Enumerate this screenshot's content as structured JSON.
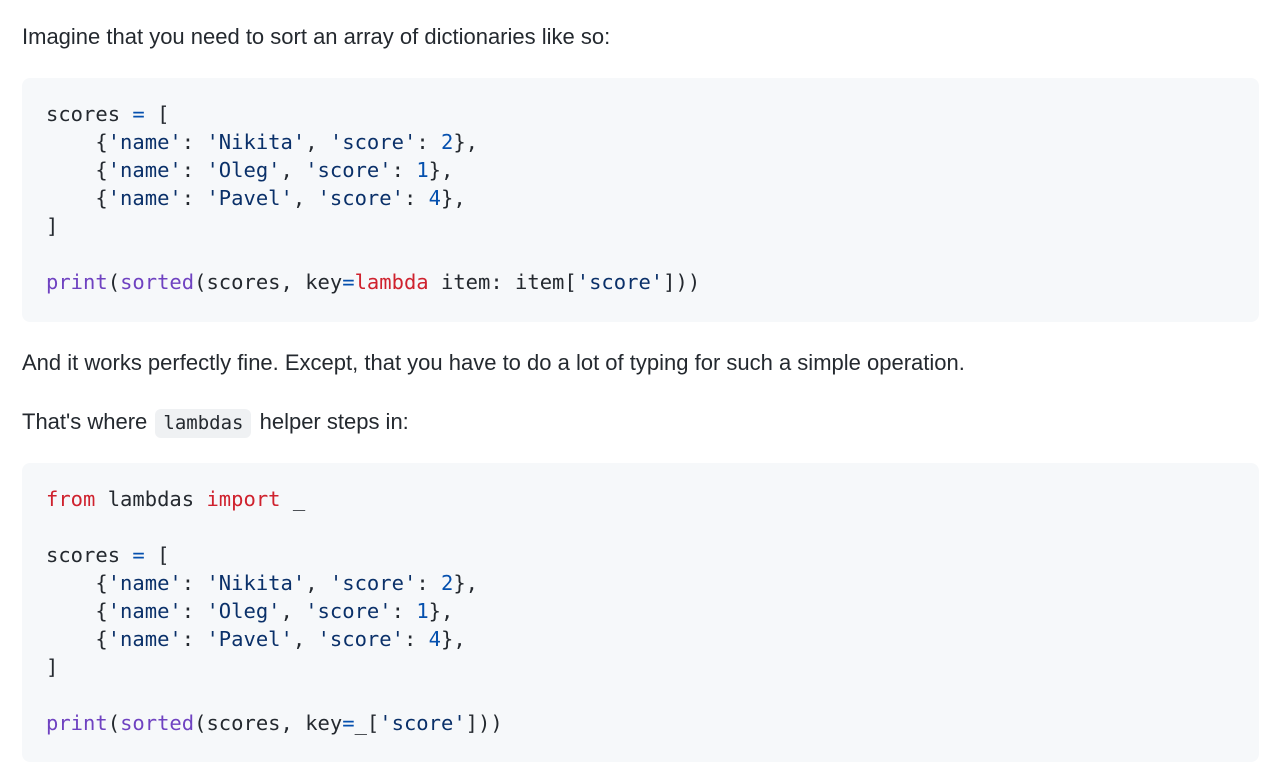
{
  "intro_text": "Imagine that you need to sort an array of dictionaries like so:",
  "middle_text": "And it works perfectly fine. Except, that you have to do a lot of typing for such a simple operation.",
  "helper": {
    "before": "That's where",
    "code": "lambdas",
    "after": "helper steps in:"
  },
  "colors": {
    "keyword": "#cf222e",
    "builtin": "#6f42c1",
    "string": "#0a3069",
    "number": "#0550ae",
    "code_background": "#f6f8fa",
    "inline_code_background": "#eff1f3"
  },
  "code_block_1": [
    [
      [
        "plain",
        "scores "
      ],
      [
        "op",
        "="
      ],
      [
        "plain",
        " ["
      ]
    ],
    [
      [
        "plain",
        "    {"
      ],
      [
        "str",
        "'name'"
      ],
      [
        "plain",
        ": "
      ],
      [
        "str",
        "'Nikita'"
      ],
      [
        "plain",
        ", "
      ],
      [
        "str",
        "'score'"
      ],
      [
        "plain",
        ": "
      ],
      [
        "num",
        "2"
      ],
      [
        "plain",
        "},"
      ]
    ],
    [
      [
        "plain",
        "    {"
      ],
      [
        "str",
        "'name'"
      ],
      [
        "plain",
        ": "
      ],
      [
        "str",
        "'Oleg'"
      ],
      [
        "plain",
        ", "
      ],
      [
        "str",
        "'score'"
      ],
      [
        "plain",
        ": "
      ],
      [
        "num",
        "1"
      ],
      [
        "plain",
        "},"
      ]
    ],
    [
      [
        "plain",
        "    {"
      ],
      [
        "str",
        "'name'"
      ],
      [
        "plain",
        ": "
      ],
      [
        "str",
        "'Pavel'"
      ],
      [
        "plain",
        ", "
      ],
      [
        "str",
        "'score'"
      ],
      [
        "plain",
        ": "
      ],
      [
        "num",
        "4"
      ],
      [
        "plain",
        "},"
      ]
    ],
    [
      [
        "plain",
        "]"
      ]
    ],
    [],
    [
      [
        "fn",
        "print"
      ],
      [
        "plain",
        "("
      ],
      [
        "fn",
        "sorted"
      ],
      [
        "plain",
        "(scores, key"
      ],
      [
        "op",
        "="
      ],
      [
        "kw",
        "lambda"
      ],
      [
        "plain",
        " item: item["
      ],
      [
        "str",
        "'score'"
      ],
      [
        "plain",
        "]))"
      ]
    ]
  ],
  "code_block_2": [
    [
      [
        "kw",
        "from"
      ],
      [
        "plain",
        " lambdas "
      ],
      [
        "kw",
        "import"
      ],
      [
        "plain",
        " _"
      ]
    ],
    [],
    [
      [
        "plain",
        "scores "
      ],
      [
        "op",
        "="
      ],
      [
        "plain",
        " ["
      ]
    ],
    [
      [
        "plain",
        "    {"
      ],
      [
        "str",
        "'name'"
      ],
      [
        "plain",
        ": "
      ],
      [
        "str",
        "'Nikita'"
      ],
      [
        "plain",
        ", "
      ],
      [
        "str",
        "'score'"
      ],
      [
        "plain",
        ": "
      ],
      [
        "num",
        "2"
      ],
      [
        "plain",
        "},"
      ]
    ],
    [
      [
        "plain",
        "    {"
      ],
      [
        "str",
        "'name'"
      ],
      [
        "plain",
        ": "
      ],
      [
        "str",
        "'Oleg'"
      ],
      [
        "plain",
        ", "
      ],
      [
        "str",
        "'score'"
      ],
      [
        "plain",
        ": "
      ],
      [
        "num",
        "1"
      ],
      [
        "plain",
        "},"
      ]
    ],
    [
      [
        "plain",
        "    {"
      ],
      [
        "str",
        "'name'"
      ],
      [
        "plain",
        ": "
      ],
      [
        "str",
        "'Pavel'"
      ],
      [
        "plain",
        ", "
      ],
      [
        "str",
        "'score'"
      ],
      [
        "plain",
        ": "
      ],
      [
        "num",
        "4"
      ],
      [
        "plain",
        "},"
      ]
    ],
    [
      [
        "plain",
        "]"
      ]
    ],
    [],
    [
      [
        "fn",
        "print"
      ],
      [
        "plain",
        "("
      ],
      [
        "fn",
        "sorted"
      ],
      [
        "plain",
        "(scores, key"
      ],
      [
        "op",
        "="
      ],
      [
        "plain",
        "_["
      ],
      [
        "str",
        "'score'"
      ],
      [
        "plain",
        "]))"
      ]
    ]
  ]
}
